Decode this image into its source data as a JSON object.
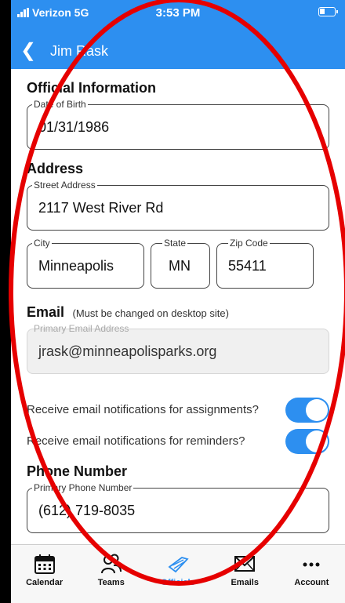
{
  "status": {
    "carrier": "Verizon 5G",
    "time": "3:53 PM"
  },
  "nav": {
    "back_icon": "chevron-left-icon",
    "title": "Jim Rask"
  },
  "official": {
    "heading": "Official Information",
    "dob_label": "Date of Birth",
    "dob_value": "01/31/1986"
  },
  "address": {
    "heading": "Address",
    "street_label": "Street Address",
    "street_value": "2117 West River Rd",
    "city_label": "City",
    "city_value": "Minneapolis",
    "state_label": "State",
    "state_value": "MN",
    "zip_label": "Zip Code",
    "zip_value": "55411"
  },
  "email": {
    "heading": "Email",
    "note": "(Must be changed on desktop site)",
    "label": "Primary Email Address",
    "value": "jrask@minneapolisparks.org"
  },
  "notifications": [
    {
      "label": "Receive email notifications for assignments?",
      "on": true
    },
    {
      "label": "Receive email notifications for reminders?",
      "on": true
    }
  ],
  "phone": {
    "heading": "Phone Number",
    "label": "Primary Phone Number",
    "value": "(612) 719-8035"
  },
  "tabs": [
    {
      "label": "Calendar",
      "icon": "calendar-icon"
    },
    {
      "label": "Teams",
      "icon": "teams-icon"
    },
    {
      "label": "Officials",
      "icon": "whistle-icon",
      "active": true
    },
    {
      "label": "Emails",
      "icon": "envelope-icon"
    },
    {
      "label": "Account",
      "icon": "more-icon"
    }
  ],
  "colors": {
    "accent": "#2d8ff0",
    "annotation": "#e60000"
  }
}
